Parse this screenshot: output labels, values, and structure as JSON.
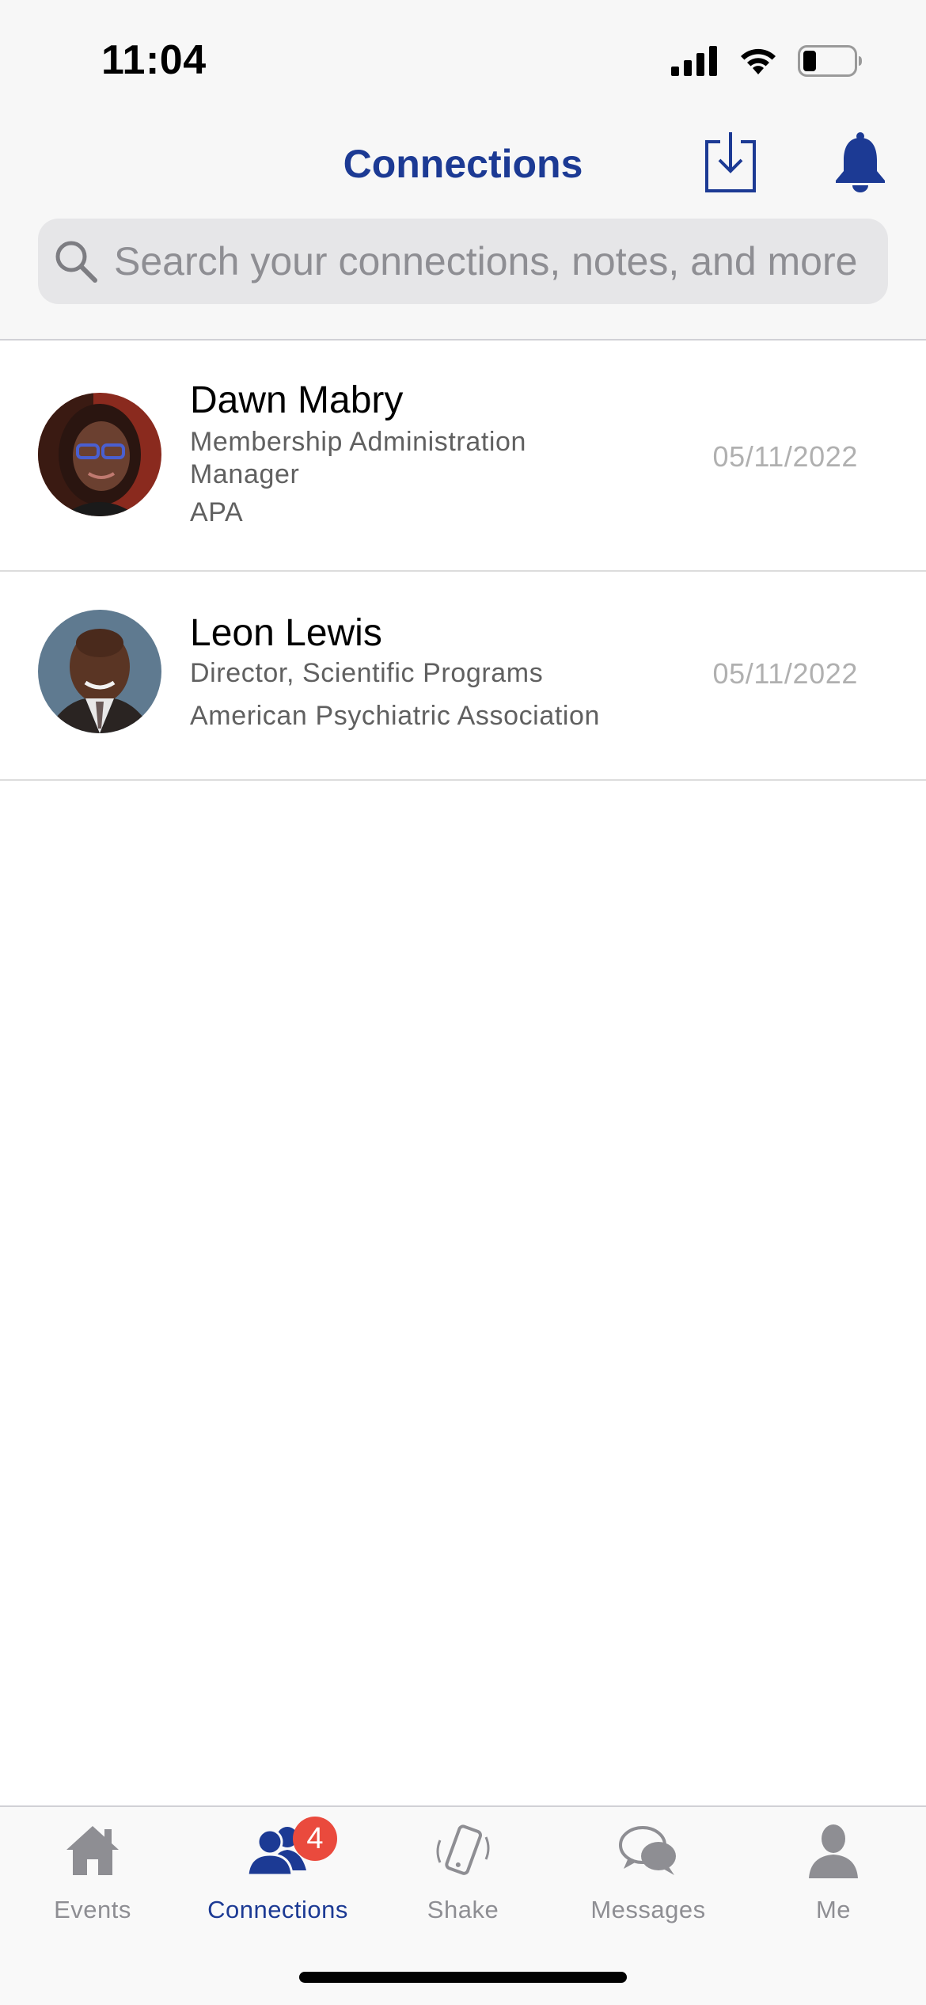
{
  "status_bar": {
    "time": "11:04",
    "icons": [
      "cellular-signal-icon",
      "wifi-icon",
      "battery-icon"
    ]
  },
  "header": {
    "title": "Connections",
    "actions": [
      "download-icon",
      "bell-icon"
    ]
  },
  "search": {
    "placeholder": "Search your connections, notes, and more",
    "value": ""
  },
  "connections": [
    {
      "name": "Dawn Mabry",
      "title_line1": "Membership Administration",
      "title_line2": "Manager",
      "organization": "APA",
      "date": "05/11/2022"
    },
    {
      "name": "Leon Lewis",
      "title_line1": "Director, Scientific Programs",
      "organization": "American Psychiatric Association",
      "date": "05/11/2022"
    }
  ],
  "tabbar": {
    "tabs": [
      {
        "label": "Events",
        "icon": "home-icon",
        "active": false
      },
      {
        "label": "Connections",
        "icon": "people-icon",
        "active": true,
        "badge": "4"
      },
      {
        "label": "Shake",
        "icon": "phone-shake-icon",
        "active": false
      },
      {
        "label": "Messages",
        "icon": "chat-bubbles-icon",
        "active": false
      },
      {
        "label": "Me",
        "icon": "person-icon",
        "active": false
      }
    ]
  },
  "colors": {
    "accent": "#1c3a94",
    "badge": "#ea4a3d",
    "inactive": "#8e8e93"
  }
}
